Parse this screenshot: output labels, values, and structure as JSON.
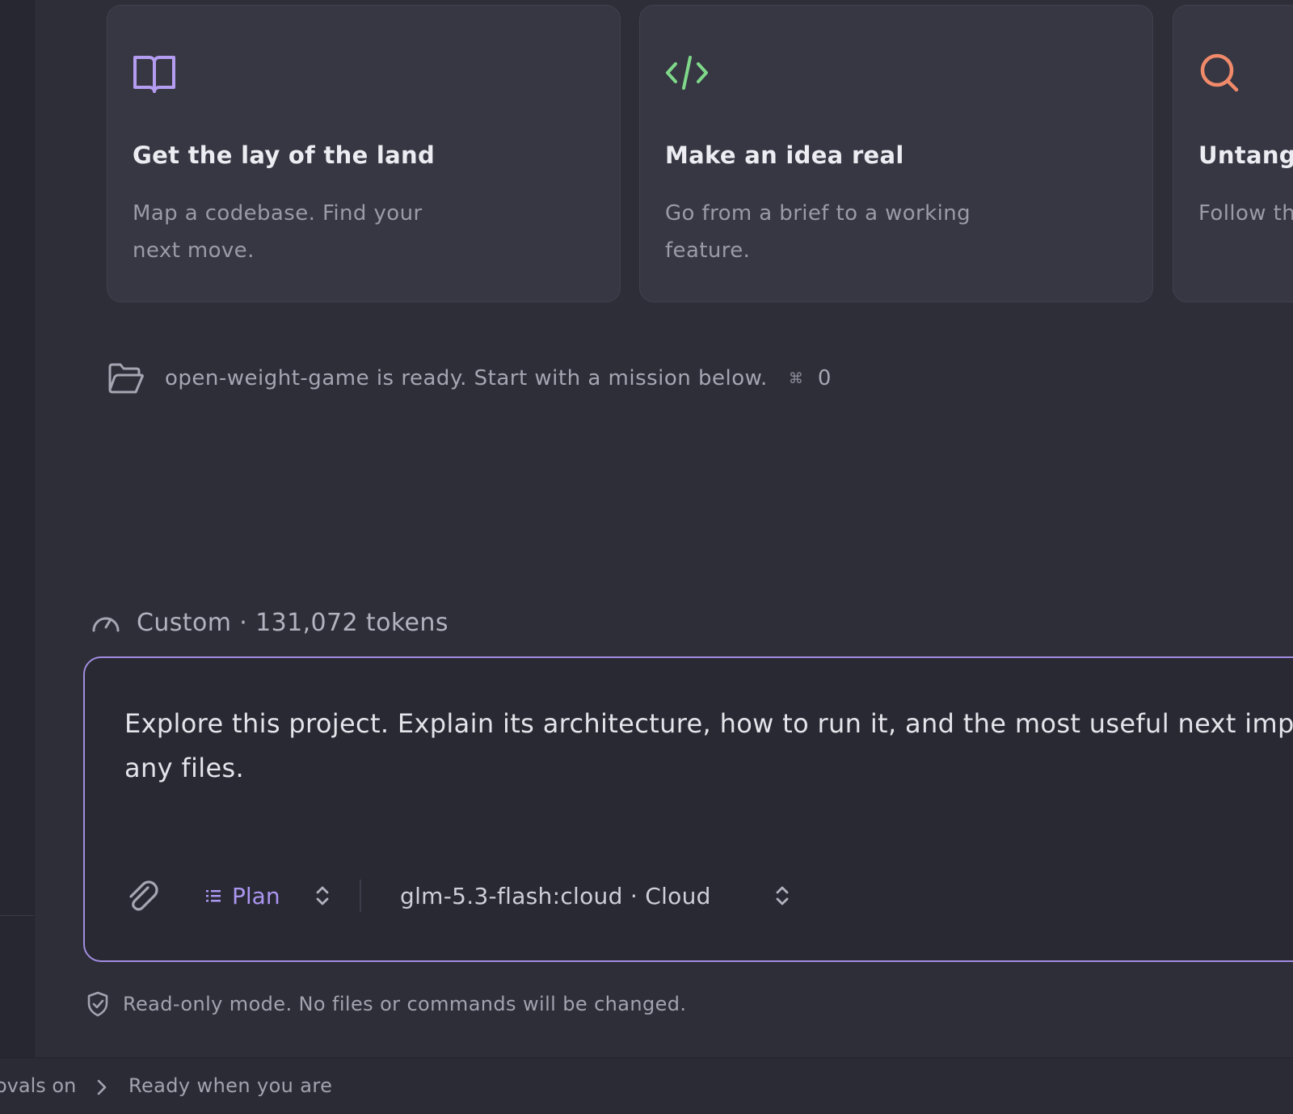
{
  "missions": [
    {
      "icon": "book-open-icon",
      "icon_color": "#b49cf0",
      "title": "Get the lay of the land",
      "description": "Map a codebase. Find your next move."
    },
    {
      "icon": "code-icon",
      "icon_color": "#7fd88a",
      "title": "Make an idea real",
      "description": "Go from a brief to a working feature."
    },
    {
      "icon": "search-icon",
      "icon_color": "#f08a6a",
      "title": "Untangl",
      "description": "Follow th clean fix"
    }
  ],
  "project_status": {
    "text": "open-weight-game is ready. Start with a mission below.",
    "shortcut_symbol": "⌘",
    "shortcut_key": "0"
  },
  "context": {
    "text": "Custom · 131,072 tokens"
  },
  "composer": {
    "prompt": "Explore this project. Explain its architecture, how to run it, and the most useful next impro\nany files.",
    "mode_label": "Plan",
    "model_label": "glm-5.3-flash:cloud · Cloud",
    "border_color": "#a38de0"
  },
  "readonly_note": "Read-only mode. No files or commands will be changed.",
  "status_bar": {
    "approvals_text": "ovals on",
    "status_text": "Ready when you are"
  },
  "colors": {
    "background": "#2d2e38",
    "card_background": "#363742",
    "accent": "#ab96f0"
  }
}
